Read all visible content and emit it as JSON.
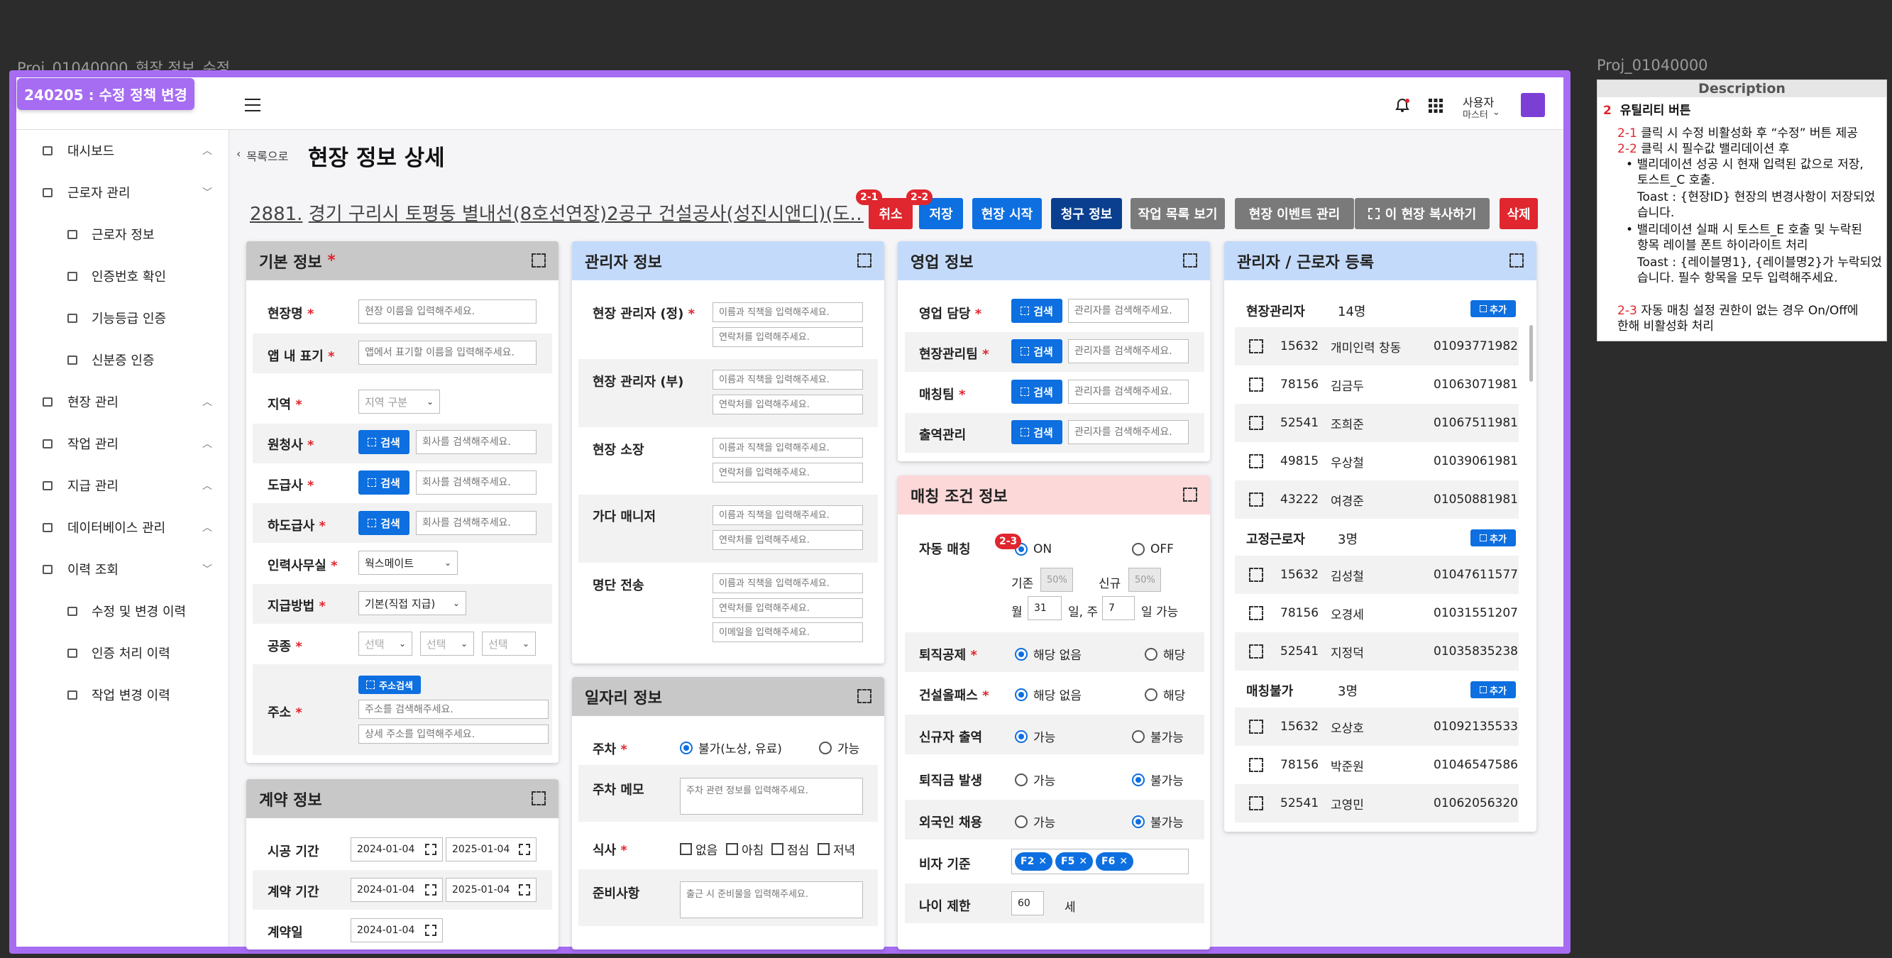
{
  "canvas": {
    "frame_title": "Proj_01040000_현장 정보_수정",
    "frame2_title": "Proj_01040000",
    "version_badge": "240205 : 수정 정책 변경"
  },
  "topbar": {
    "user_name": "사용자",
    "user_role": "마스터",
    "brand_color": "#7b3fd6"
  },
  "sidebar": {
    "items": [
      {
        "label": "대시보드",
        "level": 1,
        "chevron": "up"
      },
      {
        "label": "근로자 관리",
        "level": 1,
        "chevron": "down"
      },
      {
        "label": "근로자 정보",
        "level": 2
      },
      {
        "label": "인증번호 확인",
        "level": 2
      },
      {
        "label": "기능등급 인증",
        "level": 2
      },
      {
        "label": "신분증 인증",
        "level": 2
      },
      {
        "label": "현장 관리",
        "level": 1,
        "chevron": "up"
      },
      {
        "label": "작업 관리",
        "level": 1,
        "chevron": "up"
      },
      {
        "label": "지급 관리",
        "level": 1,
        "chevron": "up"
      },
      {
        "label": "데이터베이스 관리",
        "level": 1,
        "chevron": "up"
      },
      {
        "label": "이력 조회",
        "level": 1,
        "chevron": "down"
      },
      {
        "label": "수정 및 변경 이력",
        "level": 2
      },
      {
        "label": "인증 처리 이력",
        "level": 2
      },
      {
        "label": "작업 변경 이력",
        "level": 2
      }
    ]
  },
  "header": {
    "back_label": "목록으로",
    "page_title": "현장 정보 상세",
    "site_id": "2881.",
    "site_name": "경기 구리시 토평동 별내선(8호선연장)2공구 건설공사(성진시앤디)(도…",
    "buttons": {
      "cancel": "취소",
      "save": "저장",
      "start": "현장 시작",
      "billing": "청구 정보",
      "work_list": "작업 목록 보기",
      "events": "현장 이벤트 관리",
      "copy": "이 현장 복사하기",
      "delete": "삭제"
    }
  },
  "markers": {
    "m21": "2-1",
    "m22": "2-2",
    "m23": "2-3"
  },
  "basic": {
    "title": "기본 정보",
    "req": "*",
    "site_name_label": "현장명",
    "site_name_ph": "현장 이름을 입력해주세요.",
    "app_label": "앱 내 표기",
    "app_ph": "앱에서 표기할 이름을 입력해주세요.",
    "region_label": "지역",
    "region_value": "지역 구분",
    "prime_label": "원청사",
    "sub_label": "도급사",
    "subsub_label": "하도급사",
    "search_label": "검색",
    "company_ph": "회사를 검색해주세요.",
    "office_label": "인력사무실",
    "office_value": "웍스메이트",
    "pay_label": "지급방법",
    "pay_value": "기본(직접 지급)",
    "trade_label": "공종",
    "trade_sel": "선택",
    "addr_label": "주소",
    "addr_btn": "주소검색",
    "addr_ph": "주소를 검색해주세요.",
    "addr2_ph": "상세 주소를 입력해주세요."
  },
  "contract": {
    "title": "계약 정보",
    "build_label": "시공 기간",
    "build_from": "2024-01-04",
    "build_to": "2025-01-04",
    "contract_label": "계약 기간",
    "contract_from": "2024-01-04",
    "contract_to": "2025-01-04",
    "date_label": "계약일",
    "date_value": "2024-01-04"
  },
  "managers": {
    "title": "관리자 정보",
    "rows": [
      {
        "label": "현장 관리자 (정)",
        "required": true
      },
      {
        "label": "현장 관리자 (부)",
        "required": false
      },
      {
        "label": "현장 소장",
        "required": false
      },
      {
        "label": "가다 매니저",
        "required": false
      },
      {
        "label": "명단 전송",
        "required": false
      }
    ],
    "name_ph": "이름과 직책을 입력해주세요.",
    "phone_ph": "연락처를 입력해주세요.",
    "email_ph": "이메일을 입력해주세요."
  },
  "job": {
    "title": "일자리 정보",
    "parking_label": "주차",
    "parking_opt1": "불가(노상, 유료)",
    "parking_opt2": "가능",
    "parking_memo_label": "주차 메모",
    "parking_memo_ph": "주차 관련 정보를 입력해주세요.",
    "meal_label": "식사",
    "meal_opts": [
      "없음",
      "아침",
      "점심",
      "저녁"
    ],
    "prep_label": "준비사항",
    "prep_ph": "출근 시 준비물을 입력해주세요."
  },
  "sales": {
    "title": "영업 정보",
    "rows": [
      "영업 담당",
      "현장관리팀",
      "매칭팀",
      "출역관리"
    ],
    "required": [
      true,
      true,
      true,
      false
    ],
    "search_label": "검색",
    "ph": "관리자를 검색해주세요."
  },
  "matching": {
    "title": "매칭 조건 정보",
    "auto_label": "자동 매칭",
    "on": "ON",
    "off": "OFF",
    "base_label": "기존",
    "base_value": "50%",
    "new_label": "신규",
    "new_value": "50%",
    "month_prefix": "월",
    "month_value": "31",
    "week_mid": "일, 주",
    "week_value": "7",
    "week_suffix": "일 가능",
    "retire_label": "퇴직공제",
    "none": "해당 없음",
    "applicable": "해당",
    "pass_label": "건설올패스",
    "newbie_label": "신규자 출역",
    "possible": "가능",
    "impossible": "불가능",
    "severance_label": "퇴직금 발생",
    "foreign_label": "외국인 채용",
    "visa_label": "비자 기준",
    "visa_tags": [
      "F2",
      "F5",
      "F6"
    ],
    "age_label": "나이 제한",
    "age_value": "60",
    "age_unit": "세"
  },
  "register": {
    "title": "관리자 / 근로자 등록",
    "add_label": "추가",
    "groups": [
      {
        "label": "현장관리자",
        "count": "14명",
        "people": [
          {
            "id": "15632",
            "name": "개미인력 창동",
            "phone": "01093771982"
          },
          {
            "id": "78156",
            "name": "김금두",
            "phone": "01063071981"
          },
          {
            "id": "52541",
            "name": "조희준",
            "phone": "01067511981"
          },
          {
            "id": "49815",
            "name": "우상철",
            "phone": "01039061981"
          },
          {
            "id": "43222",
            "name": "여경준",
            "phone": "01050881981"
          }
        ]
      },
      {
        "label": "고정근로자",
        "count": "3명",
        "people": [
          {
            "id": "15632",
            "name": "김성철",
            "phone": "01047611577"
          },
          {
            "id": "78156",
            "name": "오경세",
            "phone": "01031551207"
          },
          {
            "id": "52541",
            "name": "지정덕",
            "phone": "01035835238"
          }
        ]
      },
      {
        "label": "매칭불가",
        "count": "3명",
        "people": [
          {
            "id": "15632",
            "name": "오상호",
            "phone": "01092135533"
          },
          {
            "id": "78156",
            "name": "박준원",
            "phone": "01046547586"
          },
          {
            "id": "52541",
            "name": "고영민",
            "phone": "01062056320"
          }
        ]
      }
    ]
  },
  "description": {
    "header": "Description",
    "num": "2",
    "title": "유틸리티 버튼",
    "n21": "2-1",
    "t21": "클릭 시 수정 비활성화 후 “수정” 버튼 제공",
    "n22": "2-2",
    "t22": "클릭 시 필수값 밸리데이션 후",
    "b1a": "밸리데이션 성공 시 현재 입력된 값으로 저장,",
    "b1b": "토스트_C 호출.",
    "b1c": "Toast : {현장ID} 현장의 변경사항이 저장되었",
    "b1d": "습니다.",
    "b2a": "밸리데이션 실패 시 토스트_E 호출 및 누락된",
    "b2b": "항목 레이블 폰트 하이라이트 처리",
    "b2c": "Toast : {레이블명1}, {레이블명2}가 누락되었",
    "b2d": "습니다. 필수 항목을 모두 입력해주세요.",
    "n23": "2-3",
    "t23a": "자동 매칭 설정 권한이 없는 경우 On/Off에",
    "t23b": "한해 비활성화 처리"
  }
}
